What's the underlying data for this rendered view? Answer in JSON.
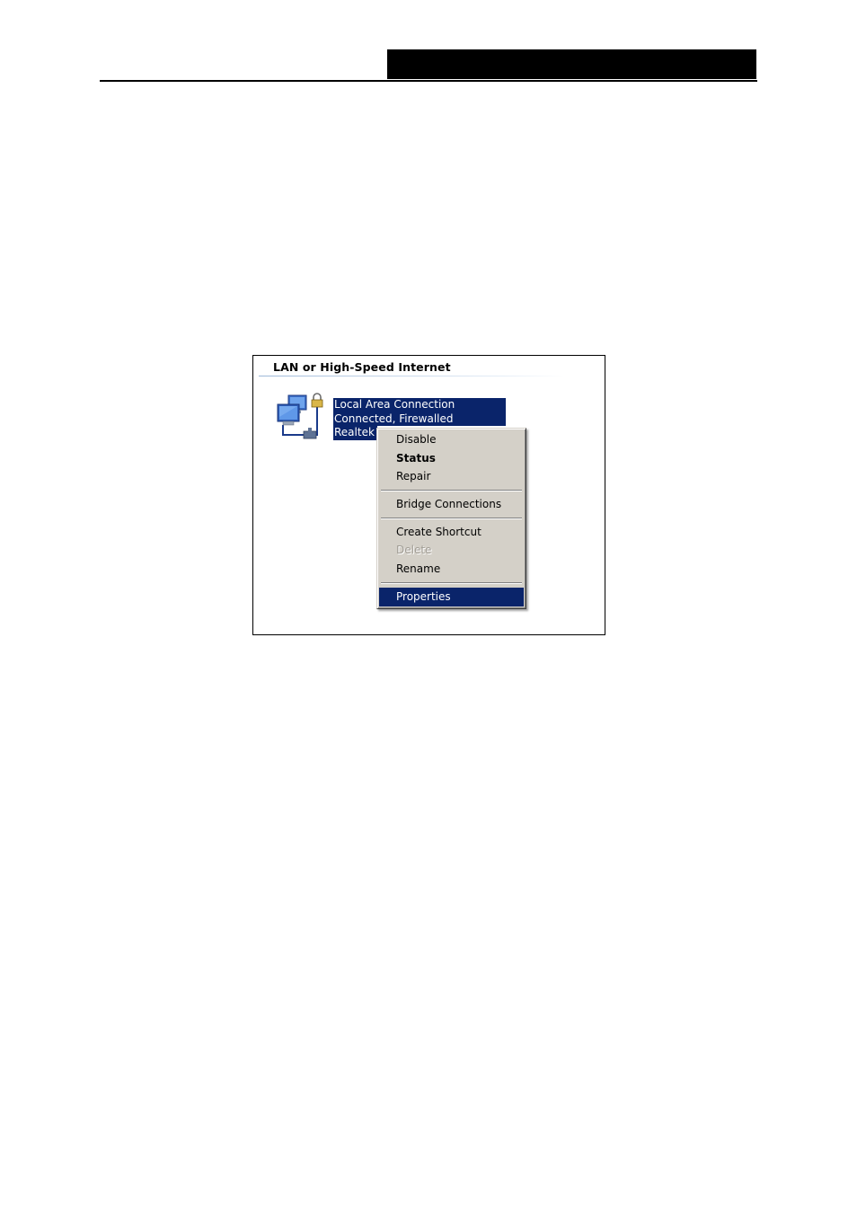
{
  "network_connections": {
    "group_header": "LAN or High-Speed Internet",
    "connection": {
      "name": "Local Area Connection",
      "status": "Connected, Firewalled",
      "device": "Realtek",
      "icon": "network-connection-lock-icon"
    }
  },
  "context_menu": {
    "items": [
      {
        "label": "Disable",
        "state": "normal"
      },
      {
        "label": "Status",
        "state": "default"
      },
      {
        "label": "Repair",
        "state": "normal"
      },
      {
        "label": "Bridge Connections",
        "state": "normal"
      },
      {
        "label": "Create Shortcut",
        "state": "normal"
      },
      {
        "label": "Delete",
        "state": "disabled"
      },
      {
        "label": "Rename",
        "state": "normal"
      },
      {
        "label": "Properties",
        "state": "selected"
      }
    ]
  },
  "colors": {
    "selection": "#0a246a",
    "menu_face": "#d4d0c8",
    "header_bar": "#000000"
  }
}
